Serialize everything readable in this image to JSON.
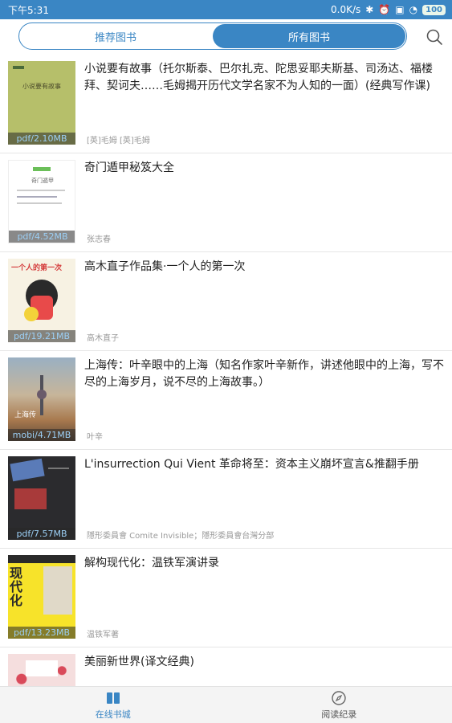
{
  "status_bar": {
    "time": "下午5:31",
    "net_speed": "0.0K/s",
    "battery": "100"
  },
  "header": {
    "tabs": [
      {
        "label": "推荐图书",
        "active": false
      },
      {
        "label": "所有图书",
        "active": true
      }
    ],
    "search_icon": "search-icon"
  },
  "books": [
    {
      "title": "小说要有故事（托尔斯泰、巴尔扎克、陀思妥耶夫斯基、司汤达、福楼拜、契诃夫……毛姆揭开历代文学名家不为人知的一面）(经典写作课)",
      "author": "[英]毛姆 [英]毛姆",
      "tag": "pdf/2.10MB",
      "cover_text": "小说要有故事"
    },
    {
      "title": "奇门遁甲秘笈大全",
      "author": "张志春",
      "tag": "pdf/4.52MB",
      "cover_text": "奇门遁甲"
    },
    {
      "title": "高木直子作品集·一个人的第一次",
      "author": "高木直子",
      "tag": "pdf/19.21MB",
      "cover_text": "一个人的第一次"
    },
    {
      "title": "上海传：叶辛眼中的上海（知名作家叶辛新作，讲述他眼中的上海，写不尽的上海岁月，说不尽的上海故事。）",
      "author": "叶辛",
      "tag": "mobi/4.71MB",
      "cover_text": "上海传"
    },
    {
      "title": "L'insurrection Qui Vient 革命将至：资本主义崩坏宣言&推翻手册",
      "author": "隱形委員會 Comite Invisible；隱形委員會台灣分部",
      "tag": "pdf/7.57MB",
      "cover_text": ""
    },
    {
      "title": "解构现代化：温铁军演讲录",
      "author": "温铁军著",
      "tag": "pdf/13.23MB",
      "cover_text": "现代化"
    },
    {
      "title": "美丽新世界(译文经典)",
      "author": "",
      "tag": "",
      "cover_text": ""
    }
  ],
  "bottom_nav": [
    {
      "label": "在线书城",
      "icon": "book-icon",
      "active": true
    },
    {
      "label": "阅读纪录",
      "icon": "compass-icon",
      "active": false
    }
  ],
  "colors": {
    "accent": "#3a86c4"
  }
}
